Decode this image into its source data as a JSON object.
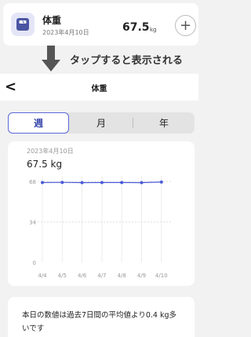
{
  "summary": {
    "label": "体重",
    "date": "2023年4月10日",
    "value": "67.5",
    "unit": "kg",
    "add_label": "+"
  },
  "hint": {
    "text": "タップすると表示される"
  },
  "header": {
    "back_label": "<",
    "title": "体重"
  },
  "segments": [
    {
      "label": "週",
      "active": true
    },
    {
      "label": "月",
      "active": false
    },
    {
      "label": "年",
      "active": false
    }
  ],
  "chart_card": {
    "date": "2023年4月10日",
    "value_text": "67.5 kg"
  },
  "chart_data": {
    "type": "line",
    "categories": [
      "4/4",
      "4/5",
      "4/6",
      "4/7",
      "4/8",
      "4/9",
      "4/10"
    ],
    "series": [
      {
        "values": [
          67.1,
          67.2,
          67.0,
          67.1,
          67.1,
          67.0,
          67.5
        ],
        "color": "#4a5bd6"
      }
    ],
    "yticks": [
      0,
      34,
      68
    ],
    "ylim": [
      0,
      68
    ],
    "grid": "vertical"
  },
  "description": {
    "text": "本日の数値は過去7日間の平均値より0.4 kg多いです"
  },
  "colors": {
    "accent": "#4a5bd6",
    "background": "#f2f2f2"
  }
}
